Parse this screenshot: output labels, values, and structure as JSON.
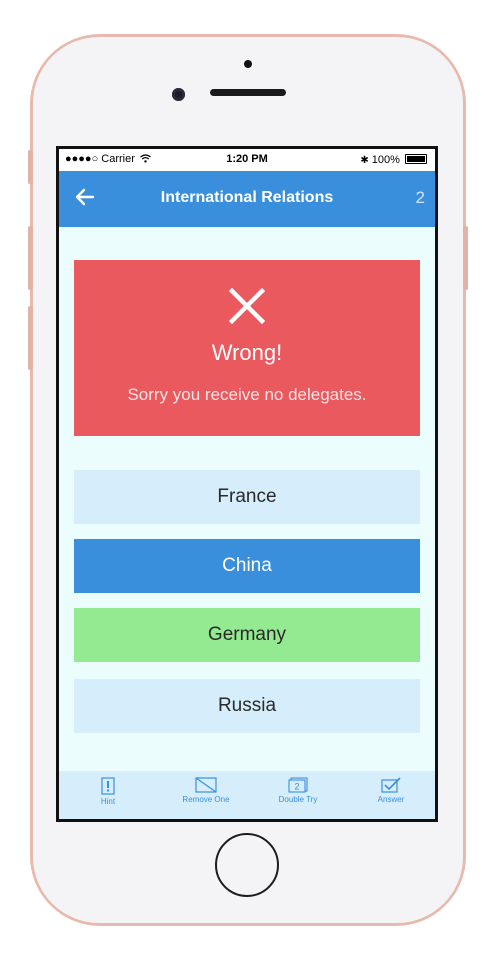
{
  "status_bar": {
    "carrier": "●●●●○ Carrier",
    "time": "1:20 PM",
    "battery": "100%"
  },
  "nav": {
    "title": "International Relations",
    "count": "2"
  },
  "result": {
    "title": "Wrong!",
    "message": "Sorry you receive no delegates.",
    "color": "#e9595e"
  },
  "options": [
    {
      "label": "France",
      "state": "plain"
    },
    {
      "label": "China",
      "state": "selected"
    },
    {
      "label": "Germany",
      "state": "correct"
    },
    {
      "label": "Russia",
      "state": "plain"
    }
  ],
  "tabs": {
    "hint": "Hint",
    "remove_one": "Remove One",
    "double_try": "Double Try",
    "double_try_icon_number": "2",
    "answer": "Answer"
  },
  "colors": {
    "accent": "#3a8fdc",
    "correct": "#93ea91",
    "option_bg": "#d6eefb",
    "screen_bg": "#ebfefd"
  }
}
